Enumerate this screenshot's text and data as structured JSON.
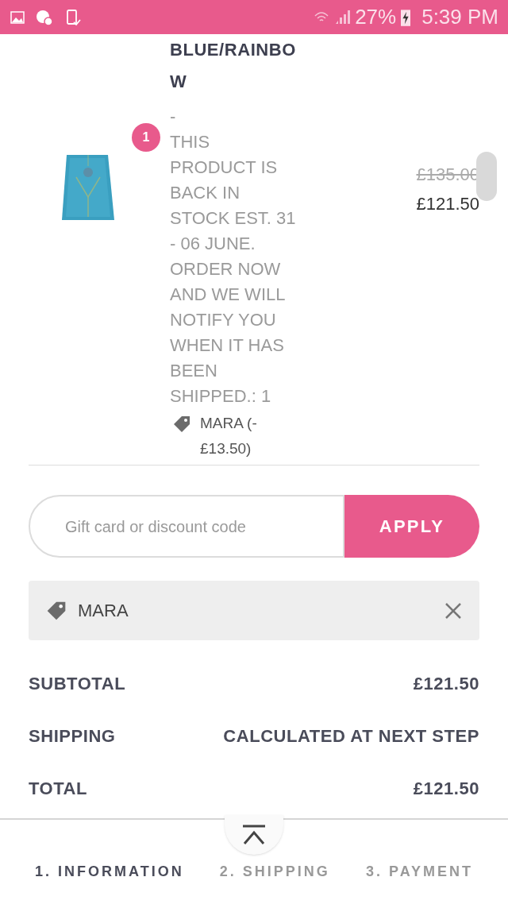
{
  "status_bar": {
    "battery": "27%",
    "time": "5:39 PM"
  },
  "product": {
    "title": "BLUE/RAINBOW",
    "dash": "-",
    "quantity": "1",
    "note": "THIS PRODUCT IS BACK IN STOCK EST. 31 - 06 JUNE. ORDER NOW AND WE WILL NOTIFY YOU WHEN IT HAS BEEN SHIPPED.: 1",
    "discount": "MARA (-£13.50)",
    "original_price": "£135.00",
    "price": "£121.50"
  },
  "discount_form": {
    "placeholder": "Gift card or discount code",
    "button": "APPLY"
  },
  "applied_code": {
    "code": "MARA"
  },
  "summary": [
    {
      "label": "SUBTOTAL",
      "value": "£121.50"
    },
    {
      "label": "SHIPPING",
      "value": "CALCULATED AT NEXT STEP"
    },
    {
      "label": "TOTAL",
      "value": "£121.50"
    }
  ],
  "steps": [
    {
      "label": "1. INFORMATION",
      "selected": true
    },
    {
      "label": "2. SHIPPING",
      "selected": false
    },
    {
      "label": "3. PAYMENT",
      "selected": false
    }
  ]
}
